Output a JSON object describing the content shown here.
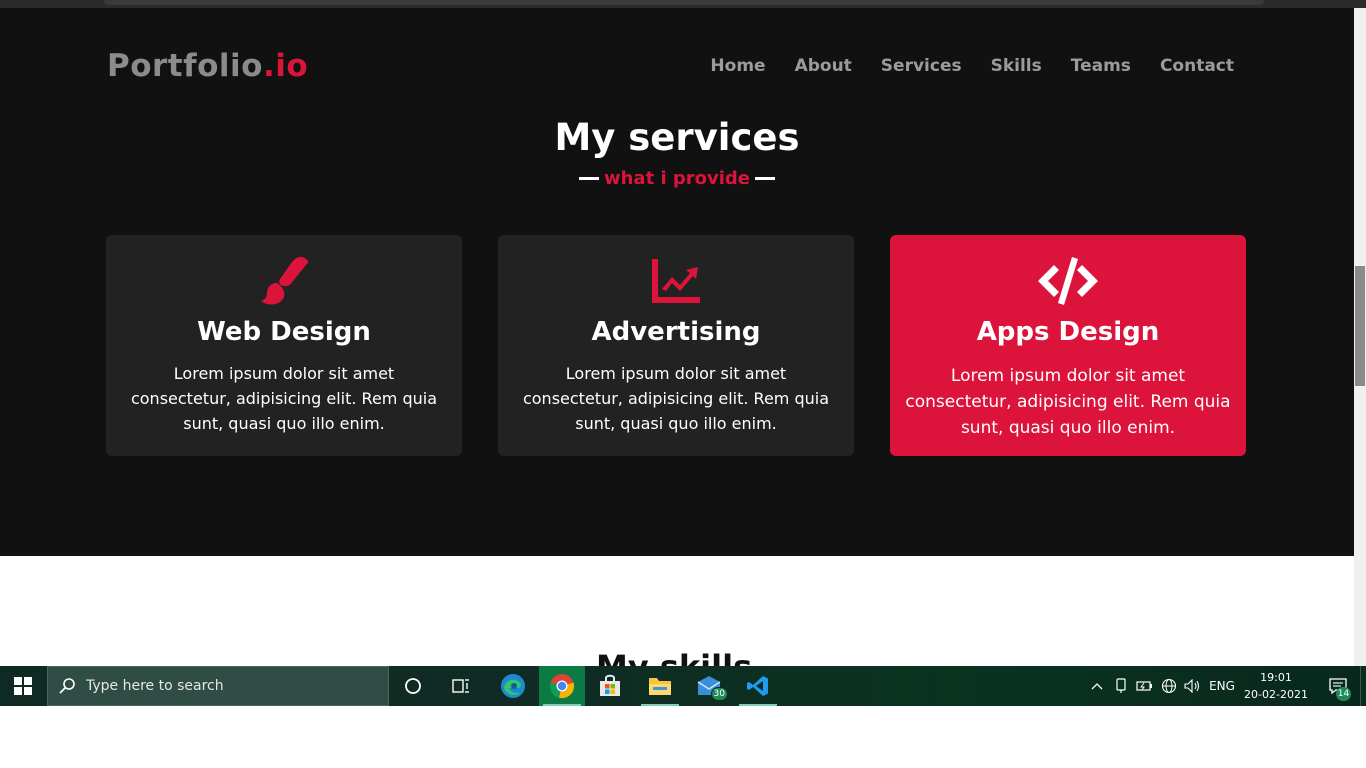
{
  "brand": {
    "name_main": "Portfolio",
    "name_accent": ".io"
  },
  "nav": {
    "items": [
      {
        "label": "Home"
      },
      {
        "label": "About"
      },
      {
        "label": "Services"
      },
      {
        "label": "Skills"
      },
      {
        "label": "Teams"
      },
      {
        "label": "Contact"
      }
    ]
  },
  "services": {
    "title": "My services",
    "subtitle": "what i provide",
    "cards": [
      {
        "title": "Web Design",
        "text": "Lorem ipsum dolor sit amet consectetur, adipisicing elit. Rem quia sunt, quasi quo illo enim.",
        "icon": "paint-brush-icon"
      },
      {
        "title": "Advertising",
        "text": "Lorem ipsum dolor sit amet consectetur, adipisicing elit. Rem quia sunt, quasi quo illo enim.",
        "icon": "chart-line-icon"
      },
      {
        "title": "Apps Design",
        "text": "Lorem ipsum dolor sit amet consectetur, adipisicing elit. Rem quia sunt, quasi quo illo enim.",
        "icon": "code-icon"
      }
    ]
  },
  "next_section": {
    "title_partial": "My skills"
  },
  "taskbar": {
    "search_placeholder": "Type here to search",
    "mail_badge": "30",
    "language": "ENG",
    "time": "19:01",
    "date": "20-02-2021",
    "notification_count": "14"
  },
  "colors": {
    "accent": "#dc143c",
    "background": "#111111",
    "card": "#222222"
  }
}
